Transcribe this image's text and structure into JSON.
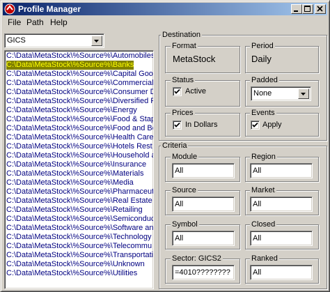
{
  "window": {
    "title": "Profile Manager"
  },
  "menu": [
    {
      "label": "File"
    },
    {
      "label": "Path"
    },
    {
      "label": "Help"
    }
  ],
  "source_combo": {
    "value": "GICS"
  },
  "list": {
    "selected_index": 1,
    "items": [
      "C:\\Data\\MetaStock\\%Source%\\Automobiles",
      "C:\\Data\\MetaStock\\%Source%\\Banks",
      "C:\\Data\\MetaStock\\%Source%\\Capital Good",
      "C:\\Data\\MetaStock\\%Source%\\Commercial",
      "C:\\Data\\MetaStock\\%Source%\\Consumer D",
      "C:\\Data\\MetaStock\\%Source%\\Diversified F",
      "C:\\Data\\MetaStock\\%Source%\\Energy",
      "C:\\Data\\MetaStock\\%Source%\\Food & Stap",
      "C:\\Data\\MetaStock\\%Source%\\Food and Be",
      "C:\\Data\\MetaStock\\%Source%\\Health Care",
      "C:\\Data\\MetaStock\\%Source%\\Hotels Rest",
      "C:\\Data\\MetaStock\\%Source%\\Household a",
      "C:\\Data\\MetaStock\\%Source%\\Insurance",
      "C:\\Data\\MetaStock\\%Source%\\Materials",
      "C:\\Data\\MetaStock\\%Source%\\Media",
      "C:\\Data\\MetaStock\\%Source%\\Pharmaceut",
      "C:\\Data\\MetaStock\\%Source%\\Real Estate",
      "C:\\Data\\MetaStock\\%Source%\\Retailing",
      "C:\\Data\\MetaStock\\%Source%\\Semiconduc",
      "C:\\Data\\MetaStock\\%Source%\\Software an",
      "C:\\Data\\MetaStock\\%Source%\\Technology",
      "C:\\Data\\MetaStock\\%Source%\\Telecommu",
      "C:\\Data\\MetaStock\\%Source%\\Transportati",
      "C:\\Data\\MetaStock\\%Source%\\Unknown",
      "C:\\Data\\MetaStock\\%Source%\\Utilities"
    ]
  },
  "destination": {
    "title": "Destination",
    "format": {
      "label": "Format",
      "value": "MetaStock"
    },
    "period": {
      "label": "Period",
      "value": "Daily"
    },
    "status": {
      "label": "Status",
      "checkbox_label": "Active",
      "checked": true
    },
    "padded": {
      "label": "Padded",
      "value": "None"
    },
    "prices": {
      "label": "Prices",
      "checkbox_label": "In Dollars",
      "checked": true
    },
    "events": {
      "label": "Events",
      "checkbox_label": "Apply",
      "checked": true
    }
  },
  "criteria": {
    "title": "Criteria",
    "module": {
      "label": "Module",
      "value": "All"
    },
    "region": {
      "label": "Region",
      "value": "All"
    },
    "source": {
      "label": "Source",
      "value": "All"
    },
    "market": {
      "label": "Market",
      "value": "All"
    },
    "symbol": {
      "label": "Symbol",
      "value": "All"
    },
    "closed": {
      "label": "Closed",
      "value": "All"
    },
    "sector": {
      "label": "Sector: GICS2",
      "value": "=4010????????"
    },
    "ranked": {
      "label": "Ranked",
      "value": "All"
    }
  },
  "colors": {
    "title_start": "#0a246a",
    "title_end": "#a6caf0",
    "list_text": "#000080",
    "selected_bg": "#808000",
    "selected_text": "#ffff00",
    "face": "#d4d0c8"
  }
}
